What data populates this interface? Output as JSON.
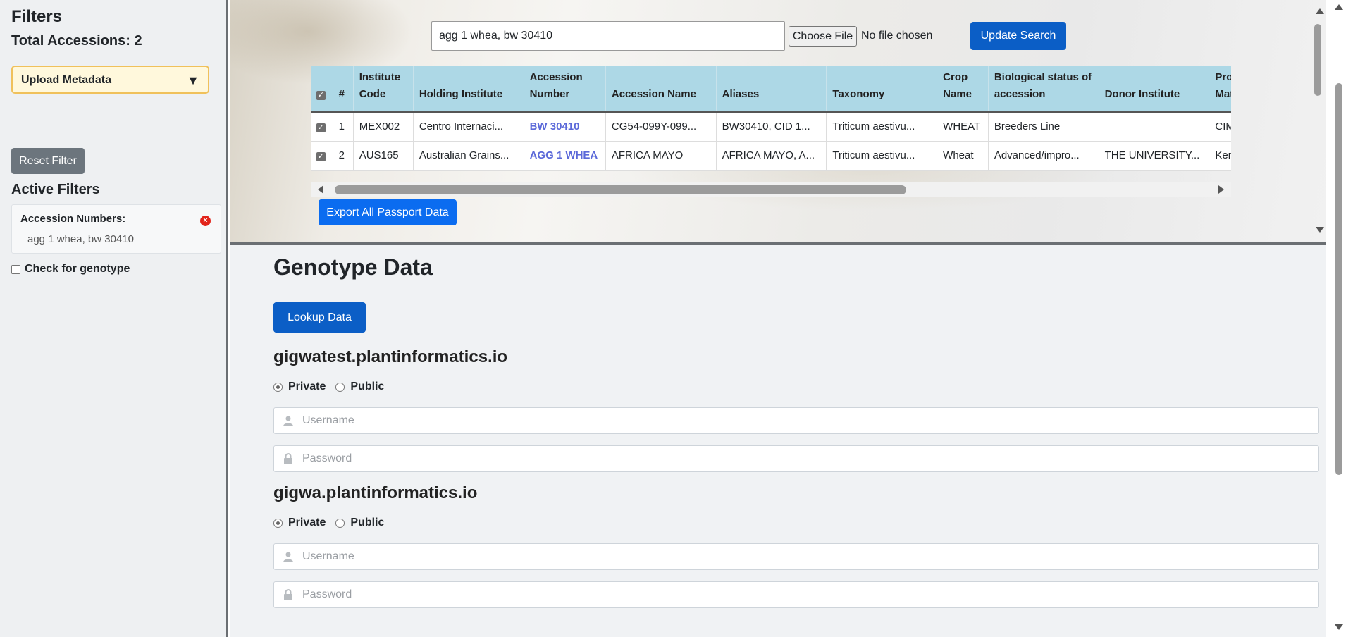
{
  "sidebar": {
    "title": "Filters",
    "total": "Total Accessions: 2",
    "upload_label": "Upload Metadata",
    "reset_label": "Reset Filter",
    "active_title": "Active Filters",
    "filter_label": "Accession Numbers:",
    "filter_value": "agg 1 whea, bw 30410",
    "genotype_check_label": "Check for genotype"
  },
  "search": {
    "value": "agg 1 whea, bw 30410",
    "choose_file": "Choose File",
    "no_file": "No file chosen",
    "update_label": "Update Search"
  },
  "table": {
    "columns": [
      "",
      "#",
      "Institute Code",
      "Holding Institute",
      "Accession Number",
      "Accession Name",
      "Aliases",
      "Taxonomy",
      "Crop Name",
      "Biological status of accession",
      "Donor Institute",
      "Provenance of Material"
    ],
    "rows": [
      [
        "1",
        "MEX002",
        "Centro Internaci...",
        "BW 30410",
        "CG54-099Y-099...",
        "BW30410, CID 1...",
        "Triticum aestivu...",
        "WHEAT",
        "Breeders Line",
        "",
        "CIMMYT"
      ],
      [
        "2",
        "AUS165",
        "Australian Grains...",
        "AGG 1 WHEA",
        "AFRICA MAYO",
        "AFRICA MAYO, A...",
        "Triticum aestivu...",
        "Wheat",
        "Advanced/impro...",
        "THE UNIVERSITY...",
        "Kenya"
      ]
    ]
  },
  "export_label": "Export All Passport Data",
  "genotype": {
    "title": "Genotype Data",
    "lookup_label": "Lookup Data",
    "hosts": [
      {
        "name": "gigwatest.plantinformatics.io",
        "private": "Private",
        "public": "Public",
        "username_ph": "Username",
        "password_ph": "Password"
      },
      {
        "name": "gigwa.plantinformatics.io",
        "private": "Private",
        "public": "Public",
        "username_ph": "Username",
        "password_ph": "Password"
      }
    ]
  },
  "colors": {
    "accent": "#0b5ec6",
    "header": "#add8e6",
    "link": "#5b69d9"
  }
}
